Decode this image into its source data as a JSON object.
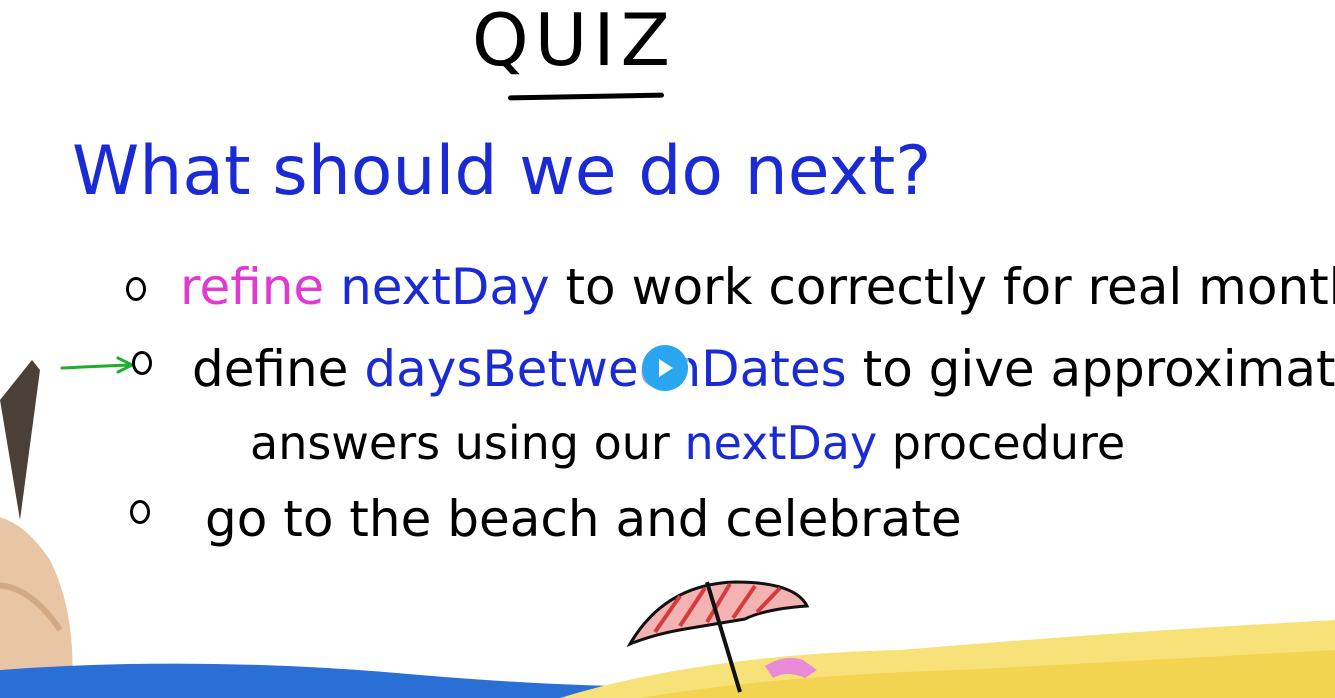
{
  "title": "QUIZ",
  "question": "What should we do next?",
  "options": [
    {
      "parts": [
        "refine",
        " nextDay",
        " to work correctly for real months"
      ]
    },
    {
      "parts": [
        "define",
        " daysBetweenDates",
        " to give approximate"
      ],
      "continuation_parts": [
        "answers using our",
        " nextDay",
        " procedure"
      ]
    },
    {
      "parts": [
        "go to the beach and celebrate"
      ]
    }
  ],
  "colors": {
    "ink_black": "#000000",
    "ink_blue": "#1a2bd6",
    "ink_pink": "#e03ad0",
    "arrow_green": "#1fae2b",
    "play_button": "#2aa6f0",
    "sand": "#f7e27a",
    "water": "#2a6fd6"
  },
  "icons": {
    "play": "play-icon",
    "selection_arrow": "arrow-right-icon",
    "umbrella": "beach-umbrella-icon"
  }
}
